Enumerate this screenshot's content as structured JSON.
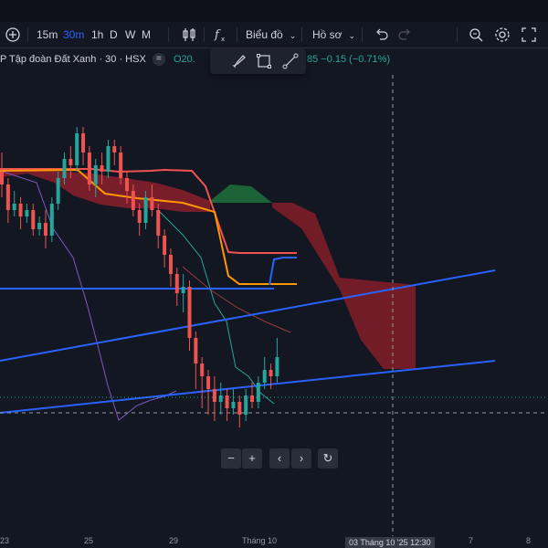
{
  "toolbar": {
    "intervals": [
      "15m",
      "30m",
      "1h",
      "D",
      "W",
      "M"
    ],
    "active_interval": "30m",
    "chart_menu_label": "Biểu đồ",
    "profile_menu_label": "Hồ sơ",
    "icons": [
      "add-circle-icon",
      "candles-icon",
      "fx-icon",
      "undo-icon",
      "redo-icon",
      "search-icon",
      "gear-icon",
      "fullscreen-icon"
    ]
  },
  "legend": {
    "symbol_text": "P Tập đoàn Đất Xanh · 30 · HSX",
    "dot": "=",
    "open_label": "O",
    "open_value_partial": "20.",
    "change_text": "85  −0.15 (−0.71%)"
  },
  "time_axis": {
    "labels": [
      "23",
      "25",
      "29",
      "Tháng 10",
      "7",
      "8"
    ],
    "crosshair_time": "03 Tháng 10 '25   12:30"
  },
  "colors": {
    "background": "#131722",
    "up": "#26a69a",
    "down": "#ef5350",
    "tenkan": "#ef5350",
    "kijun": "#ff9800",
    "trendline": "#2962ff",
    "lagging": "#7e57c2",
    "cloud_bear": "#8b1e2b",
    "cloud_bull": "#1e6b3a"
  },
  "chart_data": {
    "type": "candlestick",
    "title": "",
    "xlabel": "",
    "ylabel": "",
    "x": [
      "",
      "",
      "",
      "",
      "",
      "",
      "",
      "",
      "",
      "",
      "",
      "",
      "",
      "",
      "",
      "",
      "",
      "",
      "",
      "",
      "",
      "",
      "",
      "",
      "",
      "",
      "",
      "",
      "",
      "",
      "",
      "",
      "",
      "",
      "",
      "",
      "",
      "",
      "",
      "",
      "",
      "",
      "",
      "",
      "",
      "",
      "",
      "",
      "",
      "",
      "",
      "",
      ""
    ],
    "candles": [
      [
        0.92,
        0.9,
        0.95,
        0.88
      ],
      [
        0.9,
        0.86,
        0.91,
        0.84
      ],
      [
        0.86,
        0.87,
        0.89,
        0.85
      ],
      [
        0.87,
        0.85,
        0.88,
        0.83
      ],
      [
        0.85,
        0.86,
        0.87,
        0.84
      ],
      [
        0.86,
        0.83,
        0.87,
        0.82
      ],
      [
        0.83,
        0.84,
        0.85,
        0.82
      ],
      [
        0.84,
        0.82,
        0.86,
        0.8
      ],
      [
        0.82,
        0.87,
        0.88,
        0.81
      ],
      [
        0.87,
        0.91,
        0.92,
        0.86
      ],
      [
        0.91,
        0.94,
        0.95,
        0.9
      ],
      [
        0.94,
        0.93,
        0.96,
        0.91
      ],
      [
        0.93,
        0.98,
        0.99,
        0.92
      ],
      [
        0.98,
        0.95,
        0.99,
        0.93
      ],
      [
        0.95,
        0.9,
        0.96,
        0.89
      ],
      [
        0.9,
        0.93,
        0.94,
        0.88
      ],
      [
        0.93,
        0.92,
        0.95,
        0.9
      ],
      [
        0.92,
        0.96,
        0.97,
        0.91
      ],
      [
        0.96,
        0.95,
        0.97,
        0.93
      ],
      [
        0.95,
        0.91,
        0.96,
        0.9
      ],
      [
        0.91,
        0.89,
        0.92,
        0.87
      ],
      [
        0.89,
        0.86,
        0.9,
        0.85
      ],
      [
        0.86,
        0.84,
        0.87,
        0.82
      ],
      [
        0.84,
        0.88,
        0.89,
        0.83
      ],
      [
        0.88,
        0.86,
        0.9,
        0.85
      ],
      [
        0.86,
        0.82,
        0.87,
        0.8
      ],
      [
        0.82,
        0.79,
        0.83,
        0.77
      ],
      [
        0.79,
        0.76,
        0.8,
        0.74
      ],
      [
        0.76,
        0.73,
        0.77,
        0.71
      ],
      [
        0.73,
        0.74,
        0.76,
        0.7
      ],
      [
        0.74,
        0.66,
        0.75,
        0.64
      ],
      [
        0.66,
        0.62,
        0.67,
        0.58
      ],
      [
        0.62,
        0.6,
        0.63,
        0.55
      ],
      [
        0.6,
        0.58,
        0.61,
        0.54
      ],
      [
        0.58,
        0.56,
        0.6,
        0.53
      ],
      [
        0.56,
        0.57,
        0.59,
        0.54
      ],
      [
        0.57,
        0.55,
        0.58,
        0.53
      ],
      [
        0.55,
        0.56,
        0.58,
        0.54
      ],
      [
        0.56,
        0.54,
        0.57,
        0.52
      ],
      [
        0.54,
        0.57,
        0.58,
        0.53
      ],
      [
        0.57,
        0.56,
        0.59,
        0.55
      ],
      [
        0.56,
        0.59,
        0.6,
        0.55
      ],
      [
        0.59,
        0.61,
        0.63,
        0.58
      ],
      [
        0.61,
        0.6,
        0.62,
        0.58
      ],
      [
        0.6,
        0.63,
        0.66,
        0.59
      ]
    ],
    "ichimoku": {
      "tenkan": [
        0.9,
        0.9,
        0.9,
        0.9,
        0.9,
        0.9,
        0.9,
        0.9,
        0.9,
        0.9,
        0.91,
        0.93,
        0.95,
        0.95,
        0.95,
        0.95,
        0.95,
        0.95,
        0.95,
        0.95,
        0.95,
        0.93,
        0.93,
        0.93,
        0.92,
        0.9,
        0.86,
        0.82,
        0.79,
        0.79,
        0.79,
        0.79,
        0.79,
        0.79,
        0.79,
        0.79,
        0.79,
        0.79,
        0.79,
        0.79,
        0.79,
        0.79,
        0.79,
        0.79,
        0.79
      ],
      "kijun": [
        0.89,
        0.89,
        0.89,
        0.89,
        0.89,
        0.89,
        0.89,
        0.89,
        0.89,
        0.89,
        0.89,
        0.89,
        0.9,
        0.9,
        0.9,
        0.89,
        0.88,
        0.88,
        0.88,
        0.88,
        0.88,
        0.87,
        0.87,
        0.87,
        0.86,
        0.84,
        0.8,
        0.77,
        0.77,
        0.77,
        0.77,
        0.77,
        0.77,
        0.77,
        0.77,
        0.77,
        0.77,
        0.77,
        0.77,
        0.77,
        0.77,
        0.77,
        0.77,
        0.77,
        0.77
      ]
    },
    "ylim": [
      0.5,
      1.0
    ]
  }
}
